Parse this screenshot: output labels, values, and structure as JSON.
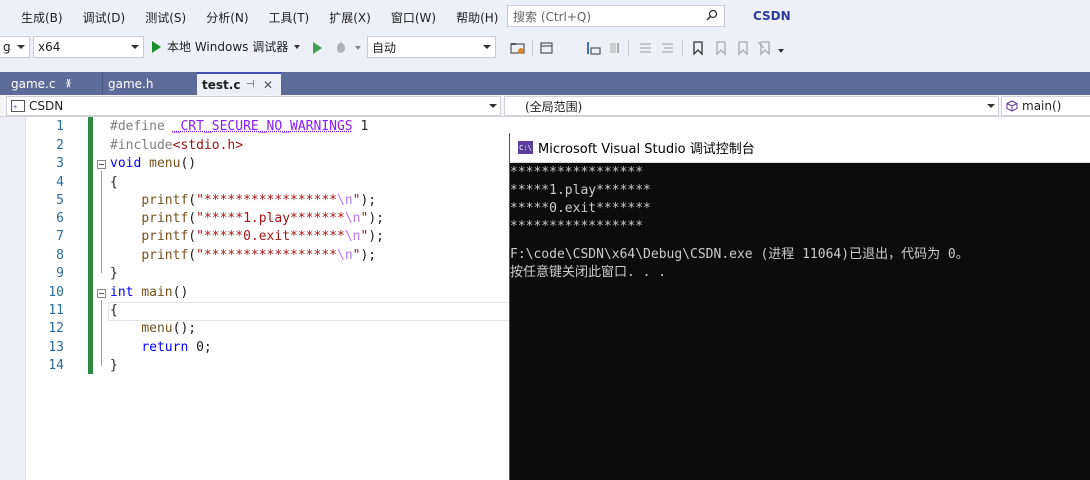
{
  "menu": {
    "items": [
      "生成(B)",
      "调试(D)",
      "测试(S)",
      "分析(N)",
      "工具(T)",
      "扩展(X)",
      "窗口(W)",
      "帮助(H)"
    ],
    "search_placeholder": "搜索 (Ctrl+Q)",
    "brand": "CSDN"
  },
  "toolbar": {
    "config_value": "g",
    "platform_value": "x64",
    "run_label": "本地 Windows 调试器",
    "solution_config": "自动"
  },
  "tabs": [
    {
      "label": "game.c",
      "active": false
    },
    {
      "label": "game.h",
      "active": false
    },
    {
      "label": "test.c",
      "active": true
    }
  ],
  "navbar": {
    "project": "CSDN",
    "scope": "(全局范围)",
    "member": "main()"
  },
  "editor": {
    "line_numbers": [
      "1",
      "2",
      "3",
      "4",
      "5",
      "6",
      "7",
      "8",
      "9",
      "10",
      "11",
      "12",
      "13",
      "14"
    ]
  },
  "console": {
    "title": "Microsoft Visual Studio 调试控制台",
    "icon_text": "C:\\",
    "lines": [
      "*****************",
      "*****1.play*******",
      "*****0.exit*******",
      "*****************",
      "",
      "F:\\code\\CSDN\\x64\\Debug\\CSDN.exe (进程 11064)已退出，代码为 0。",
      "按任意键关闭此窗口. . ."
    ]
  },
  "colors": {
    "accent": "#2b3a9b",
    "tab_strip": "#5d6b99",
    "change_bar": "#2d8a3e",
    "console_bg": "#0c0c0c"
  }
}
